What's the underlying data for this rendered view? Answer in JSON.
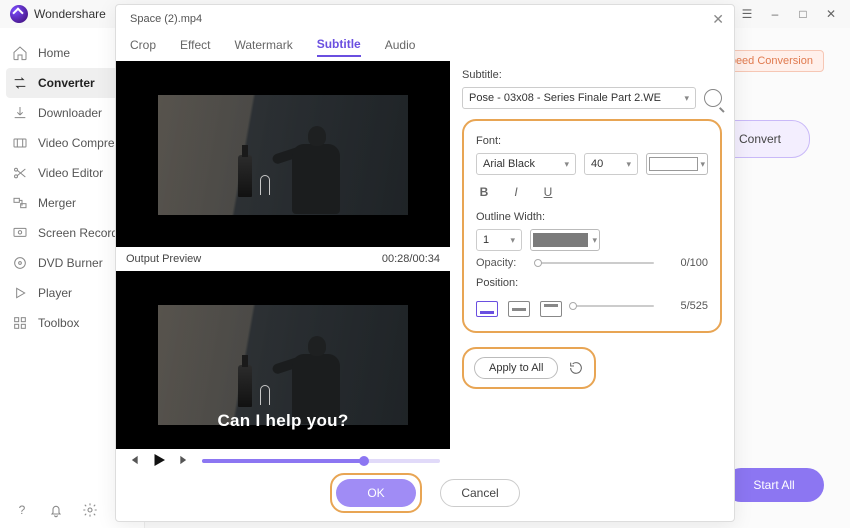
{
  "app": {
    "name": "Wondershare"
  },
  "sidebar": {
    "items": [
      {
        "label": "Home"
      },
      {
        "label": "Converter"
      },
      {
        "label": "Downloader"
      },
      {
        "label": "Video Compress"
      },
      {
        "label": "Video Editor"
      },
      {
        "label": "Merger"
      },
      {
        "label": "Screen Recorder"
      },
      {
        "label": "DVD Burner"
      },
      {
        "label": "Player"
      },
      {
        "label": "Toolbox"
      }
    ]
  },
  "main": {
    "speed_label": "Speed Conversion",
    "convert_label": "Convert",
    "startall_label": "Start All"
  },
  "modal": {
    "filename": "Space (2).mp4",
    "tabs": {
      "crop": "Crop",
      "effect": "Effect",
      "watermark": "Watermark",
      "subtitle": "Subtitle",
      "audio": "Audio"
    },
    "preview_label": "Output Preview",
    "timecode": "00:28/00:34",
    "caption_text": "Can I help you?",
    "subtitle": {
      "label": "Subtitle:",
      "selected": "Pose - 03x08 - Series Finale Part 2.WE"
    },
    "font": {
      "label": "Font:",
      "name": "Arial Black",
      "size": "40"
    },
    "outline": {
      "label": "Outline Width:",
      "width": "1"
    },
    "opacity": {
      "label": "Opacity:",
      "value": "0/100",
      "knob_pct": 2
    },
    "position": {
      "label": "Position:",
      "value": "5/525",
      "knob_pct": 3
    },
    "apply_label": "Apply to All",
    "ok_label": "OK",
    "cancel_label": "Cancel"
  }
}
